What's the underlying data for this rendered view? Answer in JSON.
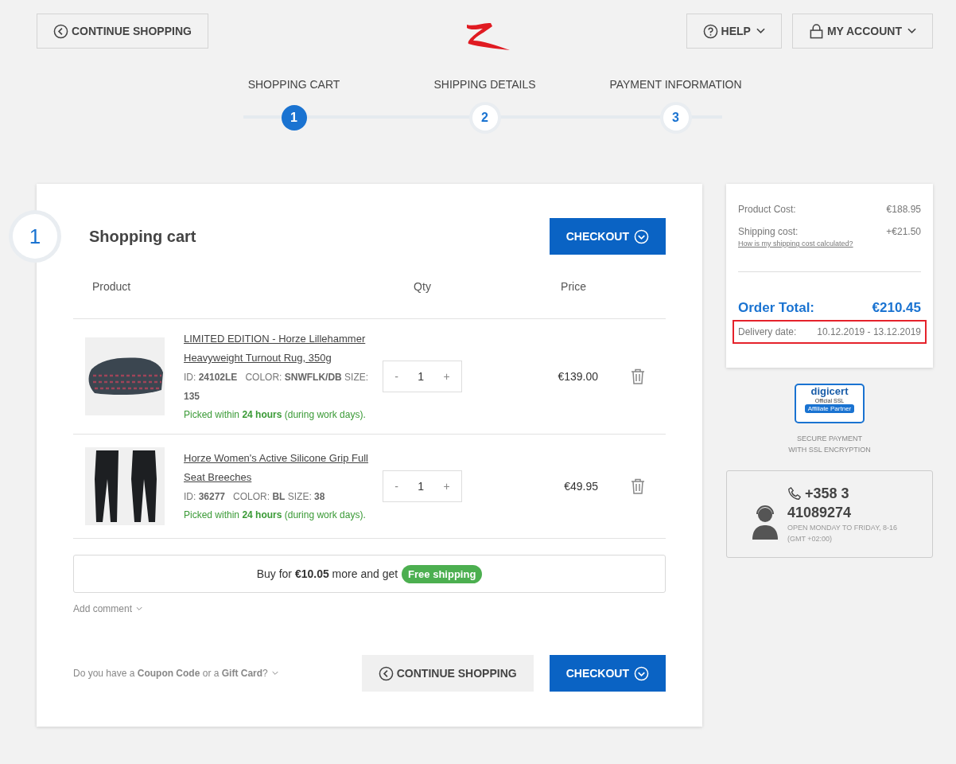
{
  "header": {
    "continue_label": "CONTINUE SHOPPING",
    "help_label": "HELP",
    "account_label": "MY ACCOUNT"
  },
  "steps": [
    {
      "label": "SHOPPING CART",
      "number": "1",
      "selected": true
    },
    {
      "label": "SHIPPING DETAILS",
      "number": "2",
      "selected": false
    },
    {
      "label": "PAYMENT INFORMATION",
      "number": "3",
      "selected": false
    }
  ],
  "cart": {
    "step_number": "1",
    "title": "Shopping cart",
    "checkout_label": "CHECKOUT",
    "columns": [
      "Product",
      "Qty",
      "Price"
    ],
    "items": [
      {
        "kind": "rug",
        "title": "LIMITED EDITION - Horze Lillehammer Heavyweight Turnout Rug, 350g",
        "details": "ID: **24102LE**   COLOR: **SNWFLK/DB** SIZE: **135**",
        "availability": "Picked within **24 hours** (during work days).",
        "minus": "-",
        "qty": "1",
        "plus": "+",
        "price": "€139.00"
      },
      {
        "kind": "breeches",
        "title": "Horze Women's Active Silicone Grip Full Seat Breeches",
        "details": "ID: **36277**   COLOR: **BL** SIZE: **38**",
        "availability": "Picked within **24 hours** (during work days).",
        "minus": "-",
        "qty": "1",
        "plus": "+",
        "price": "€49.95"
      }
    ],
    "free_shipping_text": "Buy for **€10.05** more and get",
    "free_shipping_badge": "Free shipping",
    "add_comment": "Add comment",
    "coupon_text": "Do you have a **Coupon Code** or a **Gift Card**?",
    "continue_label": "CONTINUE SHOPPING",
    "checkout_bottom_label": "CHECKOUT"
  },
  "summary": {
    "product_cost_label": "Product Cost:",
    "product_cost": "€188.95",
    "shipping_label": "Shipping cost:",
    "shipping_cost": "+€21.50",
    "shipping_link": "How is my shipping cost calculated?",
    "total_label": "Order Total:",
    "total": "€210.45",
    "delivery_label": "Delivery date:",
    "delivery_value": "10.12.2019 - 13.12.2019",
    "delivery_highlighted": true
  },
  "ssl": {
    "badge_brand": "digicert",
    "badge_line": "Official SSL",
    "badge_ribbon": "Affiliate Partner",
    "caption_1": "SECURE PAYMENT",
    "caption_2": "WITH SSL ENCRYPTION"
  },
  "support": {
    "phone_1": "+358 3",
    "phone_2": "41089274",
    "hours_1": "OPEN MONDAY TO FRIDAY, 8-16",
    "hours_2": "(GMT +02:00)"
  }
}
